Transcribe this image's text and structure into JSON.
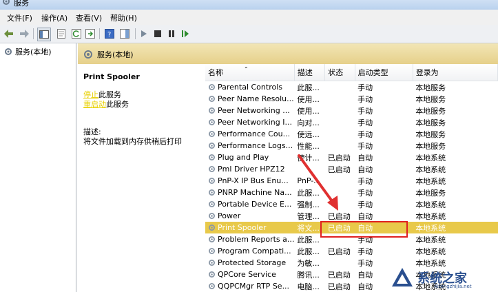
{
  "window": {
    "title": "服务"
  },
  "menu": [
    "文件(F)",
    "操作(A)",
    "查看(V)",
    "帮助(H)"
  ],
  "tree": {
    "root_label": "服务(本地)"
  },
  "panel": {
    "header_label": "服务(本地)",
    "service_name": "Print Spooler",
    "stop_link": "停止",
    "stop_suffix": "此服务",
    "restart_link": "重启动",
    "restart_suffix": "此服务",
    "desc_label": "描述:",
    "desc_text": "将文件加载到内存供稍后打印"
  },
  "table": {
    "columns": [
      "名称",
      "描述",
      "状态",
      "启动类型",
      "登录为"
    ],
    "rows": [
      {
        "name": "Parental Controls",
        "desc": "此服...",
        "status": "",
        "startup": "手动",
        "logon": "本地服务"
      },
      {
        "name": "Peer Name Resolu...",
        "desc": "使用...",
        "status": "",
        "startup": "手动",
        "logon": "本地服务"
      },
      {
        "name": "Peer Networking ...",
        "desc": "使用...",
        "status": "",
        "startup": "手动",
        "logon": "本地服务"
      },
      {
        "name": "Peer Networking I...",
        "desc": "向对...",
        "status": "",
        "startup": "手动",
        "logon": "本地服务"
      },
      {
        "name": "Performance Cou...",
        "desc": "使远...",
        "status": "",
        "startup": "手动",
        "logon": "本地服务"
      },
      {
        "name": "Performance Logs...",
        "desc": "性能...",
        "status": "",
        "startup": "手动",
        "logon": "本地服务"
      },
      {
        "name": "Plug and Play",
        "desc": "使计...",
        "status": "已启动",
        "startup": "自动",
        "logon": "本地系统"
      },
      {
        "name": "Pml Driver HPZ12",
        "desc": "",
        "status": "已启动",
        "startup": "自动",
        "logon": "本地系统"
      },
      {
        "name": "PnP-X IP Bus Enu...",
        "desc": "PnP-...",
        "status": "",
        "startup": "手动",
        "logon": "本地系统"
      },
      {
        "name": "PNRP Machine Na...",
        "desc": "此服...",
        "status": "",
        "startup": "手动",
        "logon": "本地服务"
      },
      {
        "name": "Portable Device E...",
        "desc": "强制...",
        "status": "",
        "startup": "手动",
        "logon": "本地系统"
      },
      {
        "name": "Power",
        "desc": "管理...",
        "status": "已启动",
        "startup": "自动",
        "logon": "本地系统"
      },
      {
        "name": "Print Spooler",
        "desc": "将文...",
        "status": "已启动",
        "startup": "自动",
        "logon": "本地系统",
        "selected": true
      },
      {
        "name": "Problem Reports a...",
        "desc": "此服...",
        "status": "",
        "startup": "手动",
        "logon": "本地系统"
      },
      {
        "name": "Program Compati...",
        "desc": "此服...",
        "status": "已启动",
        "startup": "手动",
        "logon": "本地系统"
      },
      {
        "name": "Protected Storage",
        "desc": "为敏...",
        "status": "",
        "startup": "手动",
        "logon": "本地系统"
      },
      {
        "name": "QPCore Service",
        "desc": "腾讯...",
        "status": "已启动",
        "startup": "自动",
        "logon": "本地系统"
      },
      {
        "name": "QQPCMgr RTP Se...",
        "desc": "电脑...",
        "status": "已启动",
        "startup": "自动",
        "logon": "本地系统"
      }
    ]
  },
  "watermark": {
    "text": "系统之家",
    "url": "Xitongzhijia.net"
  },
  "colors": {
    "selection": "#e8c94a",
    "highlight_box": "#e02020",
    "arrow": "#e03030",
    "link": "#e8d000"
  }
}
